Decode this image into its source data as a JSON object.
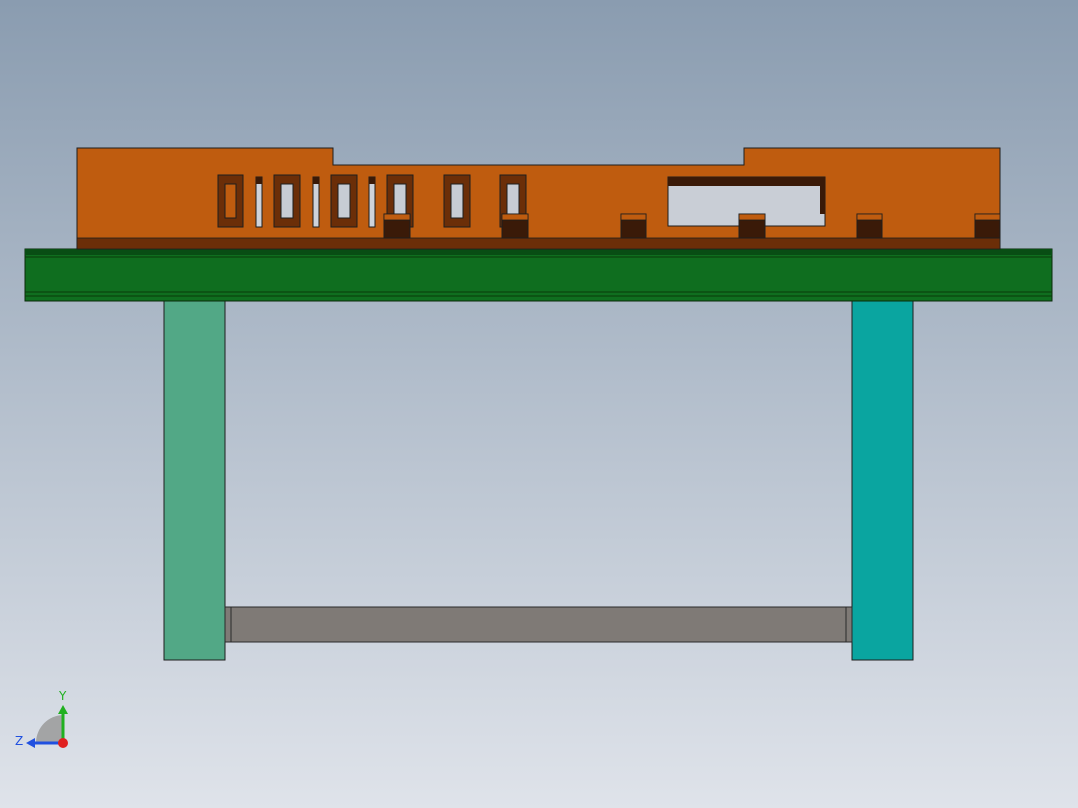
{
  "colors": {
    "background_top": "#8a9cb0",
    "background_bottom": "#dfe3ea",
    "orange_body": "#bf5c0f",
    "orange_dark": "#6b2e08",
    "dark_block": "#3a1a08",
    "green_plate": "#0f6e1f",
    "green_plate_dark": "#084d14",
    "left_leg": "#52a886",
    "right_leg": "#0aa5a0",
    "crossbar": "#7f7a76",
    "axis_x": "#e02020",
    "axis_y": "#20b020",
    "axis_z": "#2050e0"
  },
  "triad": {
    "y_label": "Y",
    "z_label": "Z"
  }
}
